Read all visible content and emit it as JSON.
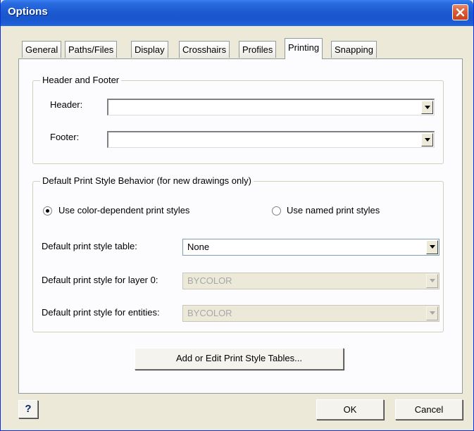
{
  "window": {
    "title": "Options",
    "close_icon": "close-icon"
  },
  "tabs": [
    {
      "label": "General"
    },
    {
      "label": "Paths/Files"
    },
    {
      "label": "Display"
    },
    {
      "label": "Crosshairs"
    },
    {
      "label": "Profiles"
    },
    {
      "label": "Printing",
      "active": true
    },
    {
      "label": "Snapping"
    }
  ],
  "header_footer": {
    "legend": "Header and Footer",
    "header_label": "Header:",
    "header_value": "",
    "footer_label": "Footer:",
    "footer_value": ""
  },
  "print_style": {
    "legend": "Default Print Style Behavior (for new drawings only)",
    "radio_color_label": "Use color-dependent print styles",
    "radio_color_selected": true,
    "radio_named_label": "Use named print styles",
    "radio_named_selected": false,
    "table_label": "Default print style table:",
    "table_value": "None",
    "layer0_label": "Default print style for layer 0:",
    "layer0_value": "BYCOLOR",
    "entities_label": "Default print style for entities:",
    "entities_value": "BYCOLOR",
    "edit_tables_button": "Add or Edit Print Style Tables..."
  },
  "footer": {
    "help_label": "?",
    "ok_label": "OK",
    "cancel_label": "Cancel"
  },
  "colors": {
    "titlebar": "#1c5ad2",
    "dialog_bg": "#ece9d8",
    "panel_bg": "#fcfcfe",
    "close_button": "#d95b35"
  }
}
